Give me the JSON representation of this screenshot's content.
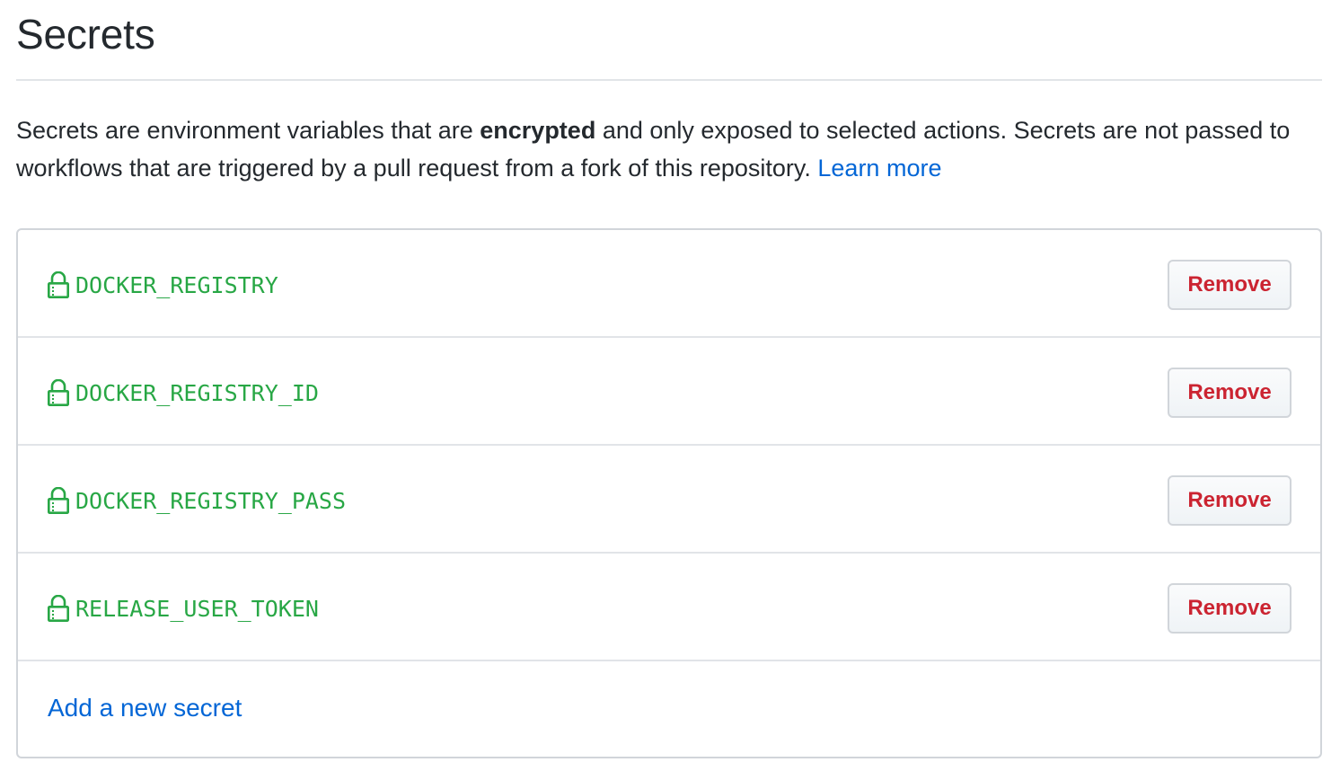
{
  "page": {
    "title": "Secrets"
  },
  "description": {
    "text_before": "Secrets are environment variables that are ",
    "bold_text": "encrypted",
    "text_after": " and only exposed to selected actions. Secrets are not passed to workflows that are triggered by a pull request from a fork of this repository. ",
    "link_label": "Learn more"
  },
  "secrets": [
    {
      "name": "DOCKER_REGISTRY",
      "icon": "lock-icon",
      "action_label": "Remove"
    },
    {
      "name": "DOCKER_REGISTRY_ID",
      "icon": "lock-icon",
      "action_label": "Remove"
    },
    {
      "name": "DOCKER_REGISTRY_PASS",
      "icon": "lock-icon",
      "action_label": "Remove"
    },
    {
      "name": "RELEASE_USER_TOKEN",
      "icon": "lock-icon",
      "action_label": "Remove"
    }
  ],
  "add_secret": {
    "label": "Add a new secret"
  },
  "colors": {
    "secret_name": "#28a745",
    "remove_text": "#cb2431",
    "link": "#0366d6",
    "border": "#d1d5da"
  }
}
